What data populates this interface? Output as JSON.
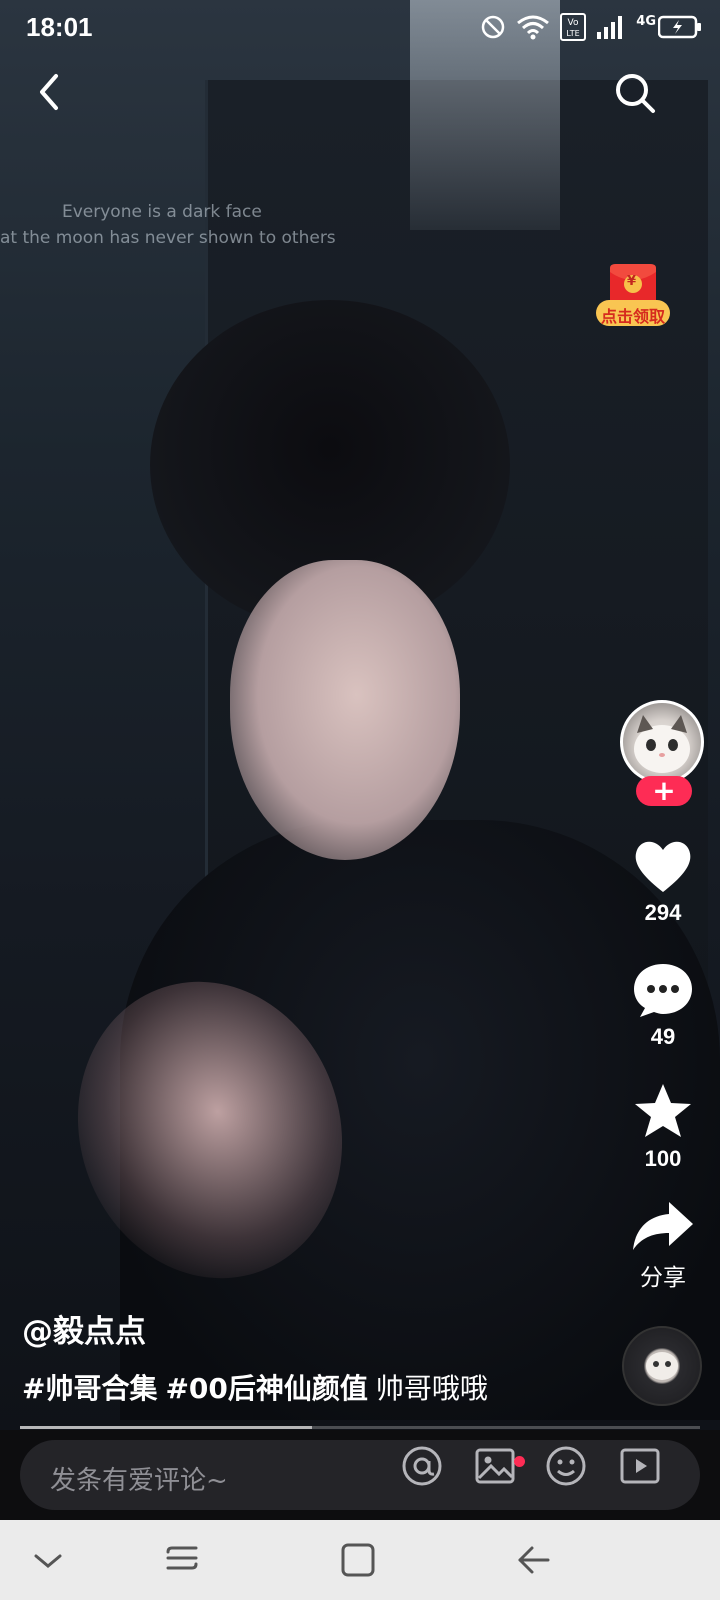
{
  "status_bar": {
    "time": "18:01",
    "network": "4G",
    "icons": [
      "dnd-off-icon",
      "wifi-icon",
      "volte-icon",
      "signal-icon",
      "battery-charging-icon"
    ]
  },
  "top_nav": {
    "back_icon": "chevron-left-icon",
    "search_icon": "search-icon"
  },
  "video": {
    "overlay_line_1": "Everyone is a dark face",
    "overlay_line_2": "at the moon has never shown to others",
    "progress_fraction": 0.43
  },
  "red_packet": {
    "label": "点击领取",
    "coin_symbol": "¥"
  },
  "sidebar": {
    "follow_symbol": "+",
    "like_count": "294",
    "comment_count": "49",
    "favorite_count": "100",
    "share_label": "分享"
  },
  "post": {
    "author": "@毅点点",
    "hashtag_1": "#帅哥合集",
    "hashtag_2": "#00后神仙颜值",
    "text": "帅哥哦哦"
  },
  "comment_bar": {
    "placeholder": "发条有爱评论~",
    "icons": [
      "at-icon",
      "image-icon",
      "emoji-icon",
      "video-icon"
    ]
  },
  "colors": {
    "accent": "#fe2c55",
    "nav_bar_bg": "#ebebeb"
  }
}
